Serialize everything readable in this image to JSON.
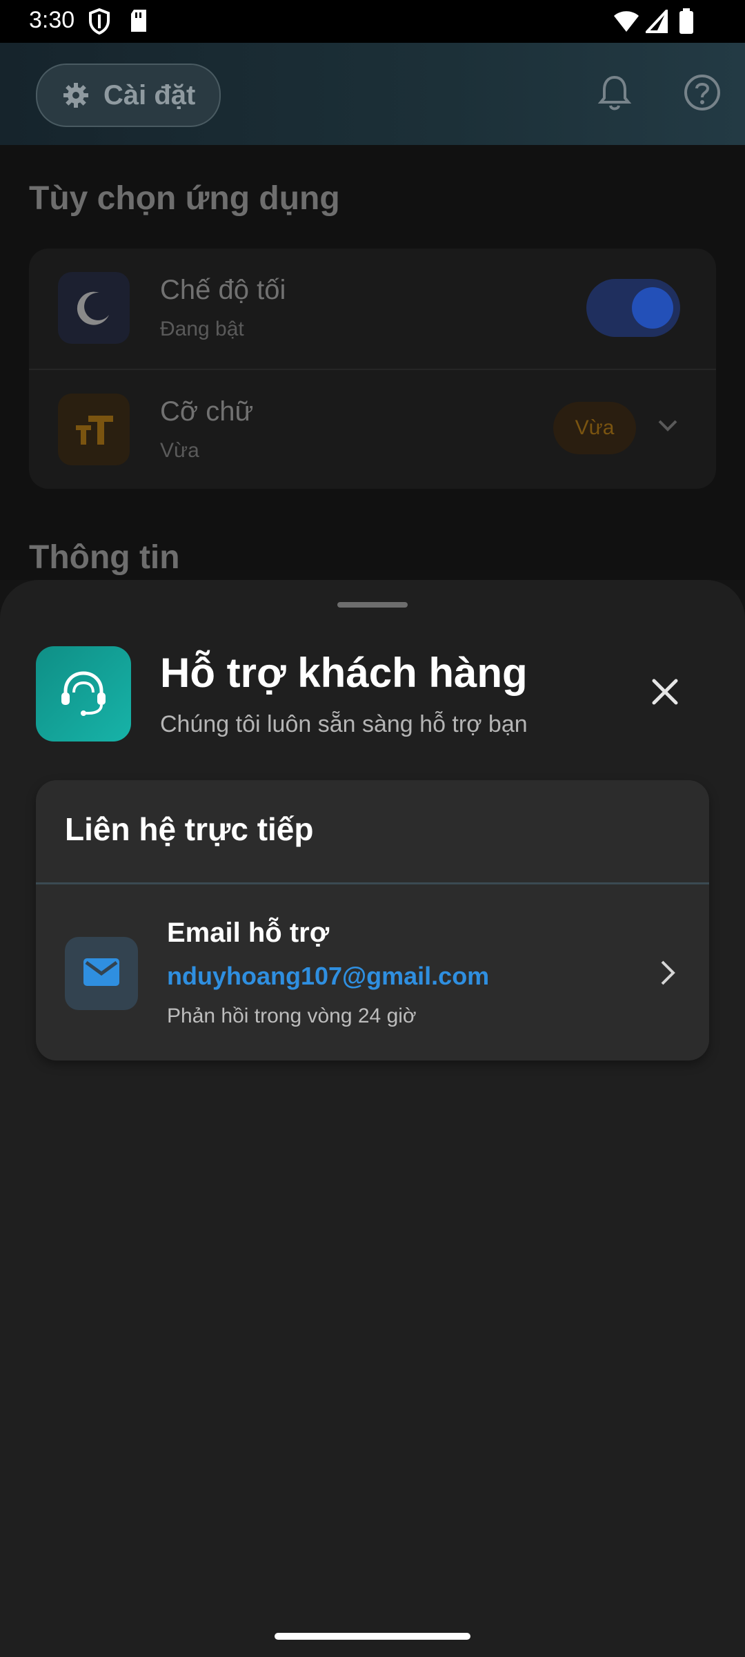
{
  "status_bar": {
    "time": "3:30",
    "icons": [
      "shield-icon",
      "sd-card-icon",
      "wifi-icon",
      "signal-icon",
      "battery-icon"
    ]
  },
  "app_bar": {
    "settings_label": "Cài đặt",
    "icons": [
      "gear-icon",
      "bell-icon",
      "help-icon"
    ]
  },
  "background": {
    "section1_title": "Tùy chọn ứng dụng",
    "dark_mode": {
      "title": "Chế độ tối",
      "subtitle": "Đang bật",
      "enabled": true
    },
    "font_size": {
      "title": "Cỡ chữ",
      "subtitle": "Vừa",
      "value": "Vừa"
    },
    "section2_title": "Thông tin"
  },
  "sheet": {
    "title": "Hỗ trợ khách hàng",
    "subtitle": "Chúng tôi luôn sẵn sàng hỗ trợ bạn",
    "contact_title": "Liên hệ trực tiếp",
    "email": {
      "title": "Email hỗ trợ",
      "address": "nduyhoang107@gmail.com",
      "note": "Phản hồi trong vòng 24 giờ"
    }
  },
  "colors": {
    "accent_teal": "#17b3a8",
    "link_blue": "#2f8fe0",
    "sheet_bg": "#1f1f1f",
    "card_bg": "#2c2c2c"
  }
}
